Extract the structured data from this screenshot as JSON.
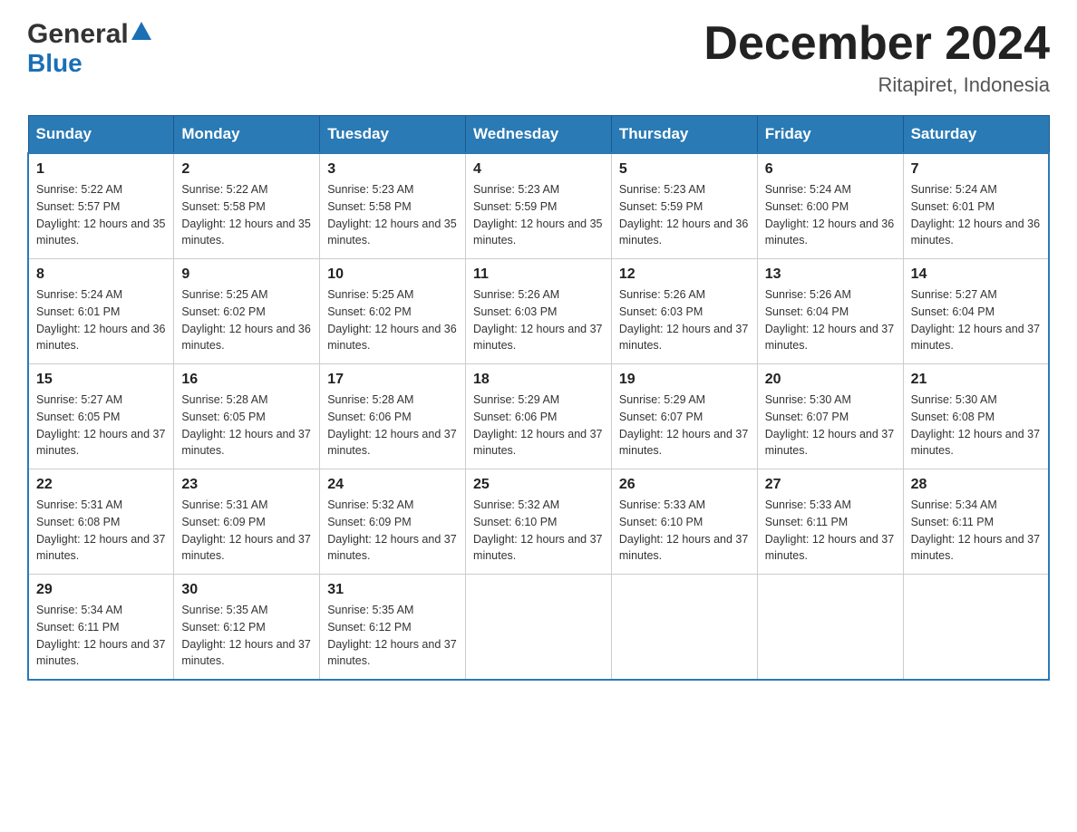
{
  "header": {
    "logo_line1": "General",
    "logo_line2": "Blue",
    "month_title": "December 2024",
    "location": "Ritapiret, Indonesia"
  },
  "days_of_week": [
    "Sunday",
    "Monday",
    "Tuesday",
    "Wednesday",
    "Thursday",
    "Friday",
    "Saturday"
  ],
  "weeks": [
    [
      {
        "day": "1",
        "sunrise": "Sunrise: 5:22 AM",
        "sunset": "Sunset: 5:57 PM",
        "daylight": "Daylight: 12 hours and 35 minutes."
      },
      {
        "day": "2",
        "sunrise": "Sunrise: 5:22 AM",
        "sunset": "Sunset: 5:58 PM",
        "daylight": "Daylight: 12 hours and 35 minutes."
      },
      {
        "day": "3",
        "sunrise": "Sunrise: 5:23 AM",
        "sunset": "Sunset: 5:58 PM",
        "daylight": "Daylight: 12 hours and 35 minutes."
      },
      {
        "day": "4",
        "sunrise": "Sunrise: 5:23 AM",
        "sunset": "Sunset: 5:59 PM",
        "daylight": "Daylight: 12 hours and 35 minutes."
      },
      {
        "day": "5",
        "sunrise": "Sunrise: 5:23 AM",
        "sunset": "Sunset: 5:59 PM",
        "daylight": "Daylight: 12 hours and 36 minutes."
      },
      {
        "day": "6",
        "sunrise": "Sunrise: 5:24 AM",
        "sunset": "Sunset: 6:00 PM",
        "daylight": "Daylight: 12 hours and 36 minutes."
      },
      {
        "day": "7",
        "sunrise": "Sunrise: 5:24 AM",
        "sunset": "Sunset: 6:01 PM",
        "daylight": "Daylight: 12 hours and 36 minutes."
      }
    ],
    [
      {
        "day": "8",
        "sunrise": "Sunrise: 5:24 AM",
        "sunset": "Sunset: 6:01 PM",
        "daylight": "Daylight: 12 hours and 36 minutes."
      },
      {
        "day": "9",
        "sunrise": "Sunrise: 5:25 AM",
        "sunset": "Sunset: 6:02 PM",
        "daylight": "Daylight: 12 hours and 36 minutes."
      },
      {
        "day": "10",
        "sunrise": "Sunrise: 5:25 AM",
        "sunset": "Sunset: 6:02 PM",
        "daylight": "Daylight: 12 hours and 36 minutes."
      },
      {
        "day": "11",
        "sunrise": "Sunrise: 5:26 AM",
        "sunset": "Sunset: 6:03 PM",
        "daylight": "Daylight: 12 hours and 37 minutes."
      },
      {
        "day": "12",
        "sunrise": "Sunrise: 5:26 AM",
        "sunset": "Sunset: 6:03 PM",
        "daylight": "Daylight: 12 hours and 37 minutes."
      },
      {
        "day": "13",
        "sunrise": "Sunrise: 5:26 AM",
        "sunset": "Sunset: 6:04 PM",
        "daylight": "Daylight: 12 hours and 37 minutes."
      },
      {
        "day": "14",
        "sunrise": "Sunrise: 5:27 AM",
        "sunset": "Sunset: 6:04 PM",
        "daylight": "Daylight: 12 hours and 37 minutes."
      }
    ],
    [
      {
        "day": "15",
        "sunrise": "Sunrise: 5:27 AM",
        "sunset": "Sunset: 6:05 PM",
        "daylight": "Daylight: 12 hours and 37 minutes."
      },
      {
        "day": "16",
        "sunrise": "Sunrise: 5:28 AM",
        "sunset": "Sunset: 6:05 PM",
        "daylight": "Daylight: 12 hours and 37 minutes."
      },
      {
        "day": "17",
        "sunrise": "Sunrise: 5:28 AM",
        "sunset": "Sunset: 6:06 PM",
        "daylight": "Daylight: 12 hours and 37 minutes."
      },
      {
        "day": "18",
        "sunrise": "Sunrise: 5:29 AM",
        "sunset": "Sunset: 6:06 PM",
        "daylight": "Daylight: 12 hours and 37 minutes."
      },
      {
        "day": "19",
        "sunrise": "Sunrise: 5:29 AM",
        "sunset": "Sunset: 6:07 PM",
        "daylight": "Daylight: 12 hours and 37 minutes."
      },
      {
        "day": "20",
        "sunrise": "Sunrise: 5:30 AM",
        "sunset": "Sunset: 6:07 PM",
        "daylight": "Daylight: 12 hours and 37 minutes."
      },
      {
        "day": "21",
        "sunrise": "Sunrise: 5:30 AM",
        "sunset": "Sunset: 6:08 PM",
        "daylight": "Daylight: 12 hours and 37 minutes."
      }
    ],
    [
      {
        "day": "22",
        "sunrise": "Sunrise: 5:31 AM",
        "sunset": "Sunset: 6:08 PM",
        "daylight": "Daylight: 12 hours and 37 minutes."
      },
      {
        "day": "23",
        "sunrise": "Sunrise: 5:31 AM",
        "sunset": "Sunset: 6:09 PM",
        "daylight": "Daylight: 12 hours and 37 minutes."
      },
      {
        "day": "24",
        "sunrise": "Sunrise: 5:32 AM",
        "sunset": "Sunset: 6:09 PM",
        "daylight": "Daylight: 12 hours and 37 minutes."
      },
      {
        "day": "25",
        "sunrise": "Sunrise: 5:32 AM",
        "sunset": "Sunset: 6:10 PM",
        "daylight": "Daylight: 12 hours and 37 minutes."
      },
      {
        "day": "26",
        "sunrise": "Sunrise: 5:33 AM",
        "sunset": "Sunset: 6:10 PM",
        "daylight": "Daylight: 12 hours and 37 minutes."
      },
      {
        "day": "27",
        "sunrise": "Sunrise: 5:33 AM",
        "sunset": "Sunset: 6:11 PM",
        "daylight": "Daylight: 12 hours and 37 minutes."
      },
      {
        "day": "28",
        "sunrise": "Sunrise: 5:34 AM",
        "sunset": "Sunset: 6:11 PM",
        "daylight": "Daylight: 12 hours and 37 minutes."
      }
    ],
    [
      {
        "day": "29",
        "sunrise": "Sunrise: 5:34 AM",
        "sunset": "Sunset: 6:11 PM",
        "daylight": "Daylight: 12 hours and 37 minutes."
      },
      {
        "day": "30",
        "sunrise": "Sunrise: 5:35 AM",
        "sunset": "Sunset: 6:12 PM",
        "daylight": "Daylight: 12 hours and 37 minutes."
      },
      {
        "day": "31",
        "sunrise": "Sunrise: 5:35 AM",
        "sunset": "Sunset: 6:12 PM",
        "daylight": "Daylight: 12 hours and 37 minutes."
      },
      null,
      null,
      null,
      null
    ]
  ]
}
